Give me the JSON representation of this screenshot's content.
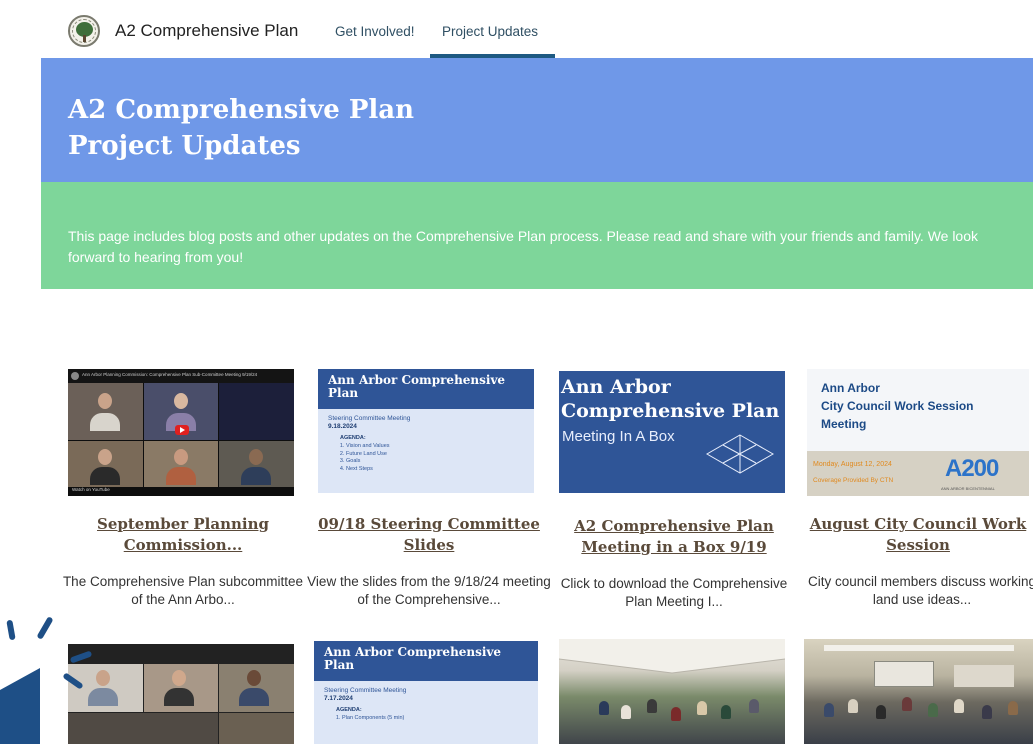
{
  "nav": {
    "site_title": "A2 Comprehensive Plan",
    "links": [
      "Get Involved!",
      "Project Updates"
    ],
    "active_link": "Project Updates"
  },
  "hero": {
    "title_line1": "A2 Comprehensive Plan",
    "title_line2": "Project Updates",
    "background": "#6f98e8"
  },
  "intro": {
    "text": "This page includes blog posts and other updates on the Comprehensive Plan process.  Please read and share with your friends and family.  We look forward to hearing from you!",
    "background": "#7ed69a"
  },
  "cards": [
    {
      "title": "September Planning Commission...",
      "desc": "The Comprehensive Plan subcommittee of the Ann Arbo...",
      "thumb": {
        "bar_title": "Ann Arbor Planning Commission: Comprehensive Plan Sub-Committee Meeting 9/19/24",
        "watch": "Watch on YouTube"
      }
    },
    {
      "title": "09/18 Steering Committee Slides",
      "desc": "View the slides from the 9/18/24 meeting of the Comprehensive...",
      "thumb": {
        "title": "Ann Arbor Comprehensive Plan",
        "meeting": "Steering Committee Meeting",
        "date": "9.18.2024",
        "agenda_label": "AGENDA:",
        "agenda": [
          "Vision and Values",
          "Future Land Use",
          "Goals",
          "Next Steps"
        ]
      }
    },
    {
      "title": "A2 Comprehensive Plan Meeting in a Box 9/19",
      "desc": "Click to download the Comprehensive Plan Meeting I...",
      "thumb": {
        "title_line1": "Ann Arbor",
        "title_line2": "Comprehensive Plan",
        "subtitle": "Meeting In A Box"
      }
    },
    {
      "title": "August City Council Work Session",
      "desc": "City council members discuss working land use ideas...",
      "thumb": {
        "line1": "Ann Arbor",
        "line2": "City Council Work Session",
        "line3": "Meeting",
        "date": "Monday, August 12, 2024",
        "coverage": "Coverage Provided By CTN",
        "logo_text": "A200",
        "logo_sub": "ANN ARBOR BICENTENNIAL"
      }
    }
  ],
  "bottom_cards": [
    {
      "thumb": "video"
    },
    {
      "thumb": {
        "title": "Ann Arbor Comprehensive Plan",
        "meeting": "Steering Committee Meeting",
        "date": "7.17.2024",
        "agenda_label": "AGENDA:",
        "agenda": [
          "Plan Components (5 min)"
        ]
      }
    },
    {
      "thumb": "photo-tent"
    },
    {
      "thumb": "photo-room"
    }
  ],
  "colors": {
    "accent_underline": "#1e5a82",
    "card_title": "#5a4a3a",
    "slide_blue": "#2f5597",
    "sparkle": "#1e4f86"
  }
}
